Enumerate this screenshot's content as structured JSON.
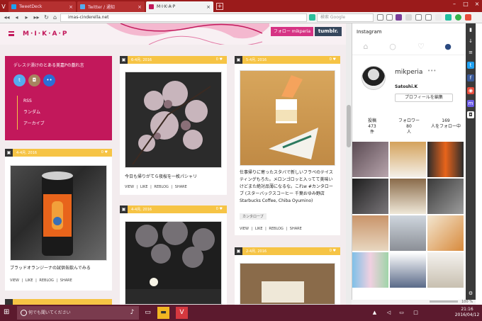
{
  "tabs": [
    {
      "label": "TweetDeck",
      "color": "#1da1f2",
      "active": false
    },
    {
      "label": "Twitter / 通知",
      "color": "#55acee",
      "active": false
    },
    {
      "label": "M·I·K·A·P",
      "color": "#c2185b",
      "active": true
    }
  ],
  "address": {
    "url": "imas-cinderella.net",
    "search_placeholder": "検索 Google"
  },
  "page": {
    "logo": "M·I·K·A·P",
    "follow_label": "フォロー mikperia",
    "tumblr_label": "tumblr.",
    "sidebar": {
      "title": "デレステ漬けのとある美嘉Pの戯れ言",
      "links": [
        "RSS",
        "ランダム",
        "アーカイブ"
      ]
    },
    "posts": [
      {
        "date": "4-4月, 2016",
        "count": "0 ♥",
        "caption": "ブラッドオランジーナの試供缶飲んでみる",
        "actions": "VIEW  |  LIKE  |  REBLOG  |  SHARE"
      },
      {
        "date": "6-4月, 2016",
        "count": "0 ♥",
        "caption": "今日も帰りがてら夜桜を一枚パシャリ",
        "actions": "VIEW  |  LIKE  |  REBLOG  |  SHARE"
      },
      {
        "date": "4-4月, 2016",
        "count": "0 ♥",
        "caption": "",
        "actions": ""
      },
      {
        "date": "5-4月, 2016",
        "count": "0 ♥",
        "caption": "仕事帰りに寄ったスタバで新しいフラペのテイスティングもろた。メロンゴロッと入ってて美味いけどまた絶対品薄になるな。これw #カンタローブ (スターバックスコーヒー 千葉おゆみ野店   Starbucks Coffee, Chiba Oyumino)",
        "tag": "カンタローブ",
        "actions": "VIEW  |  LIKE  |  REBLOG  |  SHARE"
      },
      {
        "date": "2-4月, 2016",
        "count": "0 ♥",
        "caption": "",
        "actions": ""
      }
    ]
  },
  "instagram": {
    "title": "Instagram",
    "username": "mikperia",
    "more": "•••",
    "display_name": "Satoshi.K",
    "edit_label": "プロフィールを編集",
    "stats": [
      {
        "value": "投稿",
        "label": "473",
        "unit": "件"
      },
      {
        "value": "フォロワー",
        "label": "80",
        "unit": "人"
      },
      {
        "value": "169",
        "label": "人をフォロー中",
        "unit": ""
      }
    ]
  },
  "statusbar": {
    "zoom": "100 %"
  },
  "taskbar": {
    "search_placeholder": "何でも聞いてください",
    "time": "21:16",
    "date": "2016/04/12"
  },
  "colors": {
    "brand": "#c2185b",
    "accent": "#f6c445",
    "tabbar": "#9b1b1b",
    "taskbar": "#5c1a2e"
  }
}
